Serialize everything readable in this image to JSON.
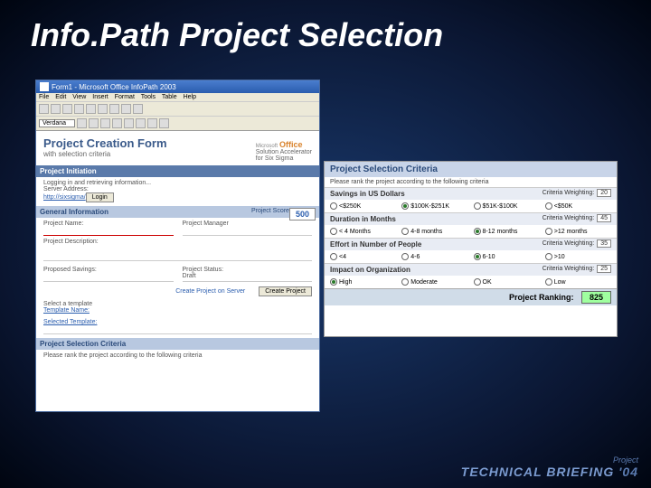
{
  "slide": {
    "title": "Info.Path Project Selection"
  },
  "window": {
    "title": "Form1 - Microsoft Office InfoPath 2003",
    "menu": [
      "File",
      "Edit",
      "View",
      "Insert",
      "Format",
      "Tools",
      "Table",
      "Help"
    ],
    "font": "Verdana"
  },
  "form": {
    "title": "Project Creation Form",
    "subtitle": "with selection criteria",
    "office_ms": "Microsoft",
    "office_of": "Office",
    "office_tag1": "Solution Accelerator",
    "office_tag2": "for Six Sigma",
    "init_hdr": "Project Initiation",
    "init_txt": "Logging in and retrieving information...",
    "server_label": "Server Address:",
    "server_url": "http://sixsigma/",
    "login": "Login",
    "gen_hdr": "General Information",
    "score_label": "Project Score",
    "score_val": "500",
    "proj_name": "Project Name:",
    "proj_mgr": "Project Manager",
    "proj_desc": "Project Description:",
    "prop_savings": "Proposed Savings:",
    "proj_status": "Project Status:",
    "status_val": "Draft",
    "select_tmpl": "Select a template",
    "tmpl_name": "Template Name:",
    "sel_tmpl": "Selected Template:",
    "create_link": "Create Project on Server",
    "create_btn": "Create Project",
    "criteria_hdr": "Project Selection Criteria",
    "criteria_sub": "Please rank the project according to the following criteria"
  },
  "criteria": {
    "title": "Project Selection Criteria",
    "sub": "Please rank the project according to the following criteria",
    "weight_label": "Criteria Weighting:",
    "sections": [
      {
        "hdr": "Savings in US Dollars",
        "weight": "20",
        "opts": [
          "<$250K",
          "$100K-$251K",
          "$51K-$100K",
          "<$50K"
        ],
        "sel": 1
      },
      {
        "hdr": "Duration in Months",
        "weight": "45",
        "opts": [
          "< 4 Months",
          "4-8 months",
          "8-12 months",
          ">12 months"
        ],
        "sel": 2
      },
      {
        "hdr": "Effort in Number of People",
        "weight": "35",
        "opts": [
          "<4",
          "4-6",
          "6-10",
          ">10"
        ],
        "sel": 2
      },
      {
        "hdr": "Impact on Organization",
        "weight": "25",
        "opts": [
          "High",
          "Moderate",
          "OK",
          "Low"
        ],
        "sel": 0
      }
    ],
    "rank_label": "Project Ranking:",
    "rank_val": "825"
  },
  "footer": {
    "proj": "Project",
    "brief1": "TECHNICAL",
    "brief2": "BRIEFING",
    "yr": "'04"
  }
}
